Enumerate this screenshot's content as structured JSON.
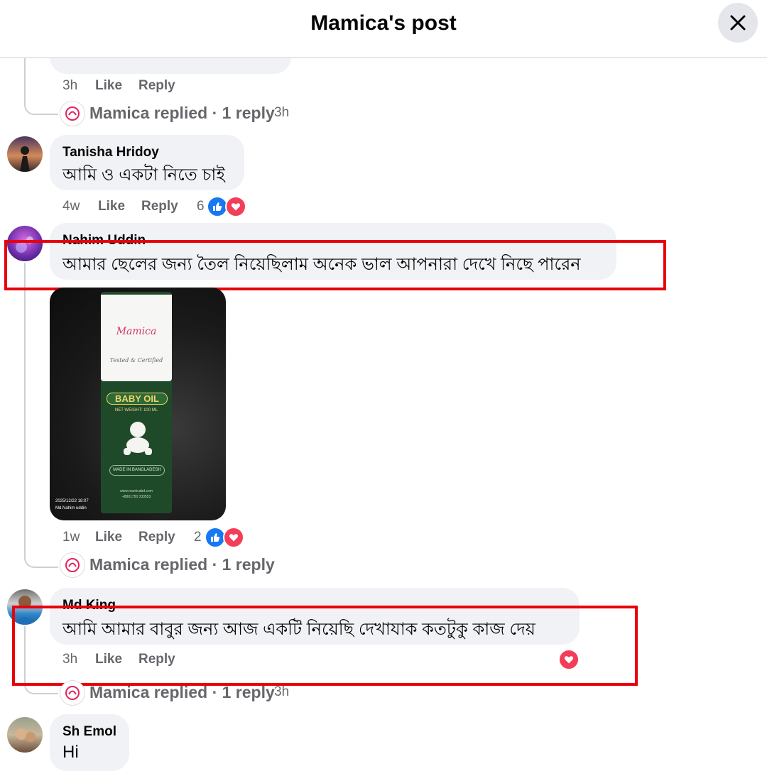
{
  "header": {
    "title": "Mamica's post",
    "close_icon": "close-icon"
  },
  "colors": {
    "highlight_box": "#e8000b",
    "like_blue": "#1877f2",
    "love_red": "#f33e58",
    "bubble_bg": "#f0f2f5",
    "meta_gray": "#65676b"
  },
  "top_reply": {
    "time": "3h",
    "like": "Like",
    "reply": "Reply",
    "replied_text": "Mamica replied · 1 reply",
    "replied_time": "3h"
  },
  "comments": [
    {
      "author": "Tanisha Hridoy",
      "text": "আমি ও একটা নিতে চাই",
      "time": "4w",
      "like": "Like",
      "reply": "Reply",
      "reaction_count": "6"
    },
    {
      "author": "Nahim Uddin",
      "text": "আমার ছেলের জন্য তৈল নিয়েছিলাম অনেক ভাল আপনারা দেখে নিছে পারেন",
      "time": "1w",
      "like": "Like",
      "reply": "Reply",
      "reaction_count": "2",
      "replied_text": "Mamica replied · 1 reply",
      "photo": {
        "brand": "Mamica",
        "tagline": "Tested & Certified",
        "product": "BABY OIL",
        "weight": "NET WEIGHT: 100 ML",
        "made_in": "MADE IN BANGLADESH",
        "website": "www.mamicabd.com",
        "phone": "+8801750 333553",
        "stamp_date": "2025/12/22 18:07",
        "stamp_name": "Md.Nahim uddin"
      }
    },
    {
      "author": "Md King",
      "text": "আমি আমার বাবুর জন্য আজ একটি নিয়েছি দেখাযাক কতটুকু কাজ দেয়",
      "time": "3h",
      "like": "Like",
      "reply": "Reply",
      "replied_text": "Mamica replied · 1 reply",
      "replied_time": "3h"
    },
    {
      "author": "Sh Emol",
      "text": "Hi"
    }
  ]
}
